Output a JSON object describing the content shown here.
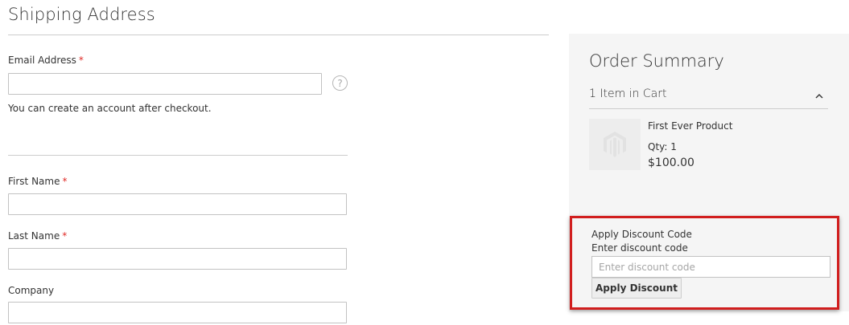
{
  "shipping": {
    "heading": "Shipping Address",
    "email": {
      "label": "Email Address",
      "required_mark": "*",
      "value": "",
      "help_icon": "question-circle-icon",
      "note": "You can create an account after checkout."
    },
    "first_name": {
      "label": "First Name",
      "required_mark": "*",
      "value": ""
    },
    "last_name": {
      "label": "Last Name",
      "required_mark": "*",
      "value": ""
    },
    "company": {
      "label": "Company",
      "value": ""
    }
  },
  "summary": {
    "title": "Order Summary",
    "cart_count_label": "1 Item in Cart",
    "toggle_icon": "chevron-up-icon",
    "item": {
      "name": "First Ever Product",
      "qty_label": "Qty: 1",
      "price": "$100.00",
      "image_icon": "magento-logo-icon"
    }
  },
  "discount": {
    "title": "Apply Discount Code",
    "subtitle": "Enter discount code",
    "input_placeholder": "Enter discount code",
    "input_value": "",
    "button_label": "Apply Discount",
    "highlight_color": "#d11e1e"
  },
  "colors": {
    "required": "#e02b27",
    "summary_bg": "#f5f5f5",
    "border": "#c2c2c2"
  }
}
